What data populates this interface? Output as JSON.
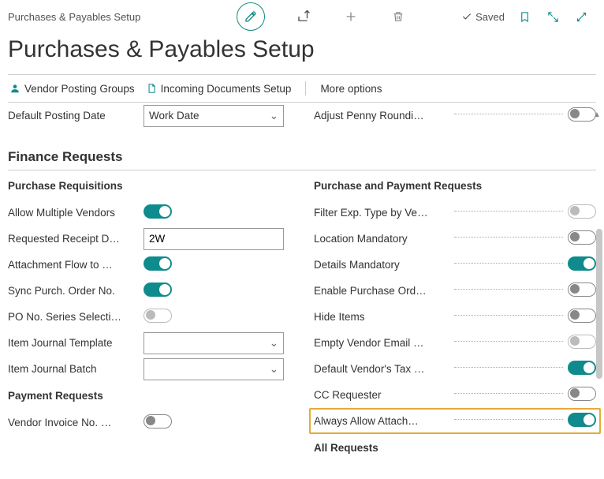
{
  "header": {
    "breadcrumb": "Purchases & Payables Setup",
    "saved_label": "Saved"
  },
  "title": "Purchases & Payables Setup",
  "action_bar": {
    "vendor_posting_groups": "Vendor Posting Groups",
    "incoming_documents_setup": "Incoming Documents Setup",
    "more_options": "More options"
  },
  "top_fields": {
    "default_posting_date_label": "Default Posting Date",
    "default_posting_date_value": "Work Date",
    "adjust_penny_label": "Adjust Penny Roundi…"
  },
  "finance_requests": {
    "section_title": "Finance Requests",
    "left": {
      "subtitle": "Purchase Requisitions",
      "fields": {
        "allow_multiple_vendors": "Allow Multiple Vendors",
        "requested_receipt": "Requested Receipt D…",
        "requested_receipt_value": "2W",
        "attachment_flow": "Attachment Flow to …",
        "sync_purch_order": "Sync Purch. Order No.",
        "po_no_series": "PO No. Series Selecti…",
        "item_journal_template": "Item Journal Template",
        "item_journal_batch": "Item Journal Batch"
      },
      "payment_requests_subtitle": "Payment Requests",
      "vendor_invoice_no": "Vendor Invoice No. …"
    },
    "right": {
      "subtitle": "Purchase and Payment Requests",
      "fields": {
        "filter_exp_type": "Filter Exp. Type by Ve…",
        "location_mandatory": "Location Mandatory",
        "details_mandatory": "Details Mandatory",
        "enable_purchase_ord": "Enable Purchase Ord…",
        "hide_items": "Hide Items",
        "empty_vendor_email": "Empty Vendor Email …",
        "default_vendor_tax": "Default Vendor's Tax …",
        "cc_requester": "CC Requester",
        "always_allow_attach": "Always Allow Attach…"
      },
      "all_requests_subtitle": "All Requests"
    }
  }
}
